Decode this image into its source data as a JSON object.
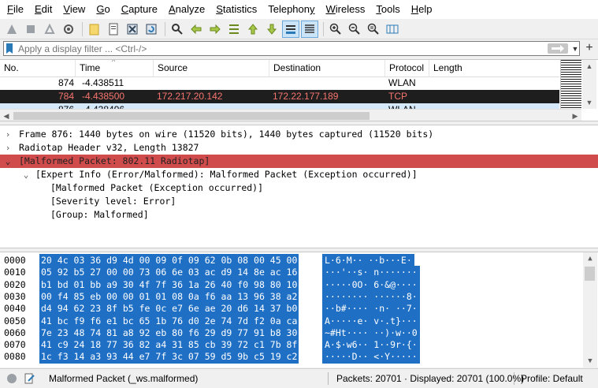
{
  "menu": [
    "File",
    "Edit",
    "View",
    "Go",
    "Capture",
    "Analyze",
    "Statistics",
    "Telephony",
    "Wireless",
    "Tools",
    "Help"
  ],
  "menu_accel": [
    "F",
    "E",
    "V",
    "G",
    "C",
    "A",
    "S",
    "y",
    "W",
    "T",
    "H"
  ],
  "filter": {
    "placeholder": "Apply a display filter ... <Ctrl-/>",
    "value": ""
  },
  "packet_list": {
    "columns": [
      "No.",
      "Time",
      "Source",
      "Destination",
      "Protocol",
      "Length"
    ],
    "rows": [
      {
        "no": "874",
        "time": "-4.438511",
        "source": "",
        "destination": "",
        "protocol": "WLAN",
        "length": ""
      },
      {
        "no": "784",
        "time": "-4.438500",
        "source": "172.217.20.142",
        "destination": "172.22.177.189",
        "protocol": "TCP",
        "length": ""
      },
      {
        "no": "876",
        "time": "-4.438496",
        "source": "",
        "destination": "",
        "protocol": "WLAN",
        "length": ""
      }
    ]
  },
  "details": {
    "frame": "Frame 876: 1440 bytes on wire (11520 bits), 1440 bytes captured (11520 bits)",
    "radiotap": "Radiotap Header v32, Length 13827",
    "malformed": "[Malformed Packet: 802.11 Radiotap]",
    "expert": "[Expert Info (Error/Malformed): Malformed Packet (Exception occurred)]",
    "expert_children": [
      "[Malformed Packet (Exception occurred)]",
      "[Severity level: Error]",
      "[Group: Malformed]"
    ]
  },
  "bytes": [
    {
      "offset": "0000",
      "hex": "20 4c 03 36 d9 4d 00 09  0f 09 62 0b 08 00 45 00",
      "ascii": " L·6·M·· ··b···E·"
    },
    {
      "offset": "0010",
      "hex": "05 92 b5 27 00 00 73 06  6e 03 ac d9 14 8e ac 16",
      "ascii": "···'··s· n·······"
    },
    {
      "offset": "0020",
      "hex": "b1 bd 01 bb a9 30 4f 7f  36 1a 26 40 f0 98 80 10",
      "ascii": "·····0O· 6·&@····"
    },
    {
      "offset": "0030",
      "hex": "00 f4 85 eb 00 00 01 01  08 0a f6 aa 13 96 38 a2",
      "ascii": "········ ······8·"
    },
    {
      "offset": "0040",
      "hex": "d4 94 62 23 8f b5 fe 0c  e7 6e ae 20 d6 14 37 b0",
      "ascii": "··b#···· ·n· ··7·"
    },
    {
      "offset": "0050",
      "hex": "41 bc f9 f6 e1 bc 65 1b  76 d0 2e 74 7d f2 0a ca",
      "ascii": "A·····e· v·.t}···"
    },
    {
      "offset": "0060",
      "hex": "7e 23 48 74 81 a8 92 eb  80 f6 29 d9 77 91 b8 30",
      "ascii": "~#Ht···· ··)·w··0"
    },
    {
      "offset": "0070",
      "hex": "41 c9 24 18 77 36 82 a4  31 85 cb 39 72 c1 7b 8f",
      "ascii": "A·$·w6·· 1··9r·{·"
    },
    {
      "offset": "0080",
      "hex": "1c f3 14 a3 93 44 e7 7f  3c 07 59 d5 9b c5 19 c2",
      "ascii": "·····D·· <·Y·····"
    }
  ],
  "status": {
    "message": "Malformed Packet (_ws.malformed)",
    "packets": "Packets: 20701 · Displayed: 20701 (100.0%)",
    "profile": "Profile: Default"
  },
  "colors": {
    "selected_row_bg": "#1e1e1e",
    "selected_row_fg": "#f7756f",
    "malformed_bg": "#d04b4b",
    "bytes_highlight": "#1f6fc5"
  }
}
